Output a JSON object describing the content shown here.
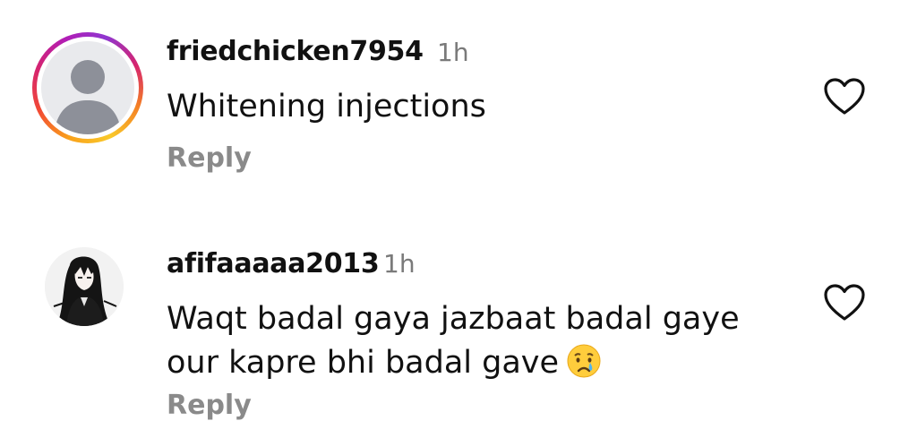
{
  "comments": [
    {
      "username": "friedchicken7954",
      "time": "1h",
      "text_lines": [
        "Whitening injections"
      ],
      "reply_label": "Reply",
      "like_icon": "heart-outline-icon",
      "avatar": "default-avatar",
      "story_ring": true
    },
    {
      "username": "afifaaaaa2013",
      "time": "1h",
      "text_lines": [
        "Waqt badal gaya jazbaat badal gaye",
        "our kapre bhi badal gave"
      ],
      "emoji": "😢",
      "reply_label": "Reply",
      "like_icon": "heart-outline-icon",
      "avatar": "anime-girl-avatar",
      "story_ring": false
    }
  ],
  "colors": {
    "text": "#111111",
    "muted": "#7a7a7a",
    "reply": "#8a8a8a",
    "ring_gradient": [
      "#f9a11b",
      "#f24a34",
      "#d6246e",
      "#b21db5",
      "#f9c92a"
    ]
  }
}
